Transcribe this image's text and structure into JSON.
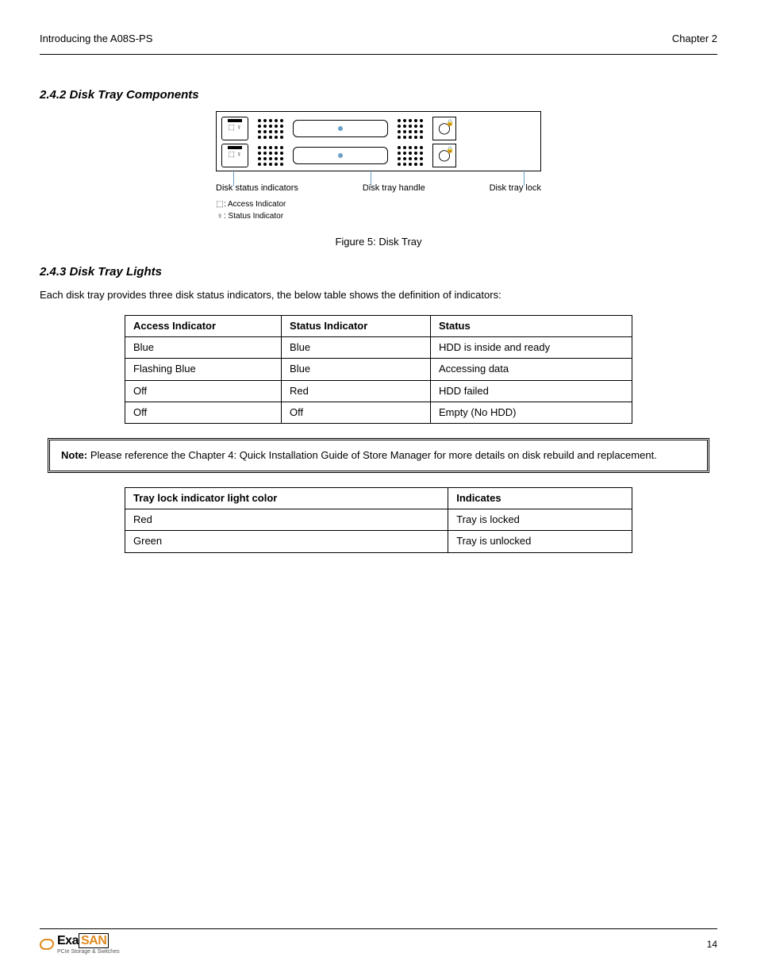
{
  "header": {
    "left": "Introducing the A08S-PS",
    "right": "Chapter 2"
  },
  "subsection_components": "2.4.2 Disk Tray Components",
  "subsection_lights": "2.4.3 Disk Tray Lights",
  "figure_caption": "Figure 5: Disk Tray",
  "diagram": {
    "callout_left": "Disk status indicators",
    "callout_mid": "Disk tray handle",
    "callout_right": "Disk tray lock",
    "legend_access": ": Access Indicator",
    "legend_status": ": Status Indicator"
  },
  "body_text": "Each disk tray provides three disk status indicators, the below table shows the definition of indicators:",
  "indicator_table": {
    "headers": [
      "Access Indicator",
      "Status Indicator",
      "Status"
    ],
    "rows": [
      [
        "Blue",
        "Blue",
        "HDD is inside and ready"
      ],
      [
        "Flashing Blue",
        "Blue",
        "Accessing data"
      ],
      [
        "Off",
        "Red",
        "HDD failed"
      ],
      [
        "Off",
        "Off",
        "Empty (No HDD)"
      ]
    ]
  },
  "note": {
    "label": "Note:",
    "text": "Please reference the Chapter 4: Quick Installation Guide of Store Manager for more details on disk rebuild and replacement."
  },
  "locklight_table": {
    "headers": [
      "Tray lock indicator light color",
      "Indicates"
    ],
    "rows": [
      [
        "Red",
        "Tray is locked"
      ],
      [
        "Green",
        "Tray is unlocked"
      ]
    ]
  },
  "footer": {
    "logo_main1": "Exa",
    "logo_main2": "SAN",
    "logo_sub": "PCIe Storage & Switches",
    "page": "14"
  }
}
